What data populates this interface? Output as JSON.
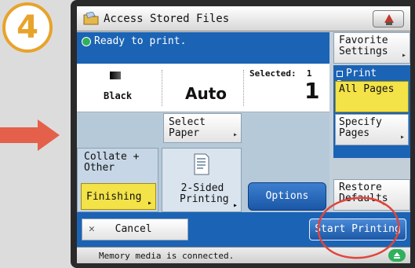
{
  "step_number": "4",
  "window": {
    "title": "Access Stored Files"
  },
  "status": {
    "message": "Ready to print."
  },
  "copy_info": {
    "color_mode": "Black",
    "paper": "Auto",
    "selected_label": "Selected:",
    "selected_small": "1",
    "selected_count": "1"
  },
  "right_panel": {
    "favorite_settings": "Favorite Settings",
    "print_range_title": "Print Range",
    "all_pages": "All Pages",
    "specify_pages": "Specify Pages",
    "restore_defaults": "Restore Defaults"
  },
  "buttons": {
    "select_paper": "Select Paper",
    "collate": "Collate + Other",
    "finishing": "Finishing",
    "two_sided": "2-Sided Printing",
    "options": "Options",
    "cancel": "Cancel",
    "start_printing": "Start Printing"
  },
  "footer": {
    "message": "Memory media is connected."
  },
  "colors": {
    "accent_blue": "#1b63b5",
    "highlight_yellow": "#f3e248",
    "step_orange": "#e8a32b",
    "annotation_red": "#e0453a"
  },
  "icons": [
    "folder-icon",
    "help-icon",
    "ok-status-icon",
    "page-icon",
    "close-icon",
    "eject-icon"
  ]
}
